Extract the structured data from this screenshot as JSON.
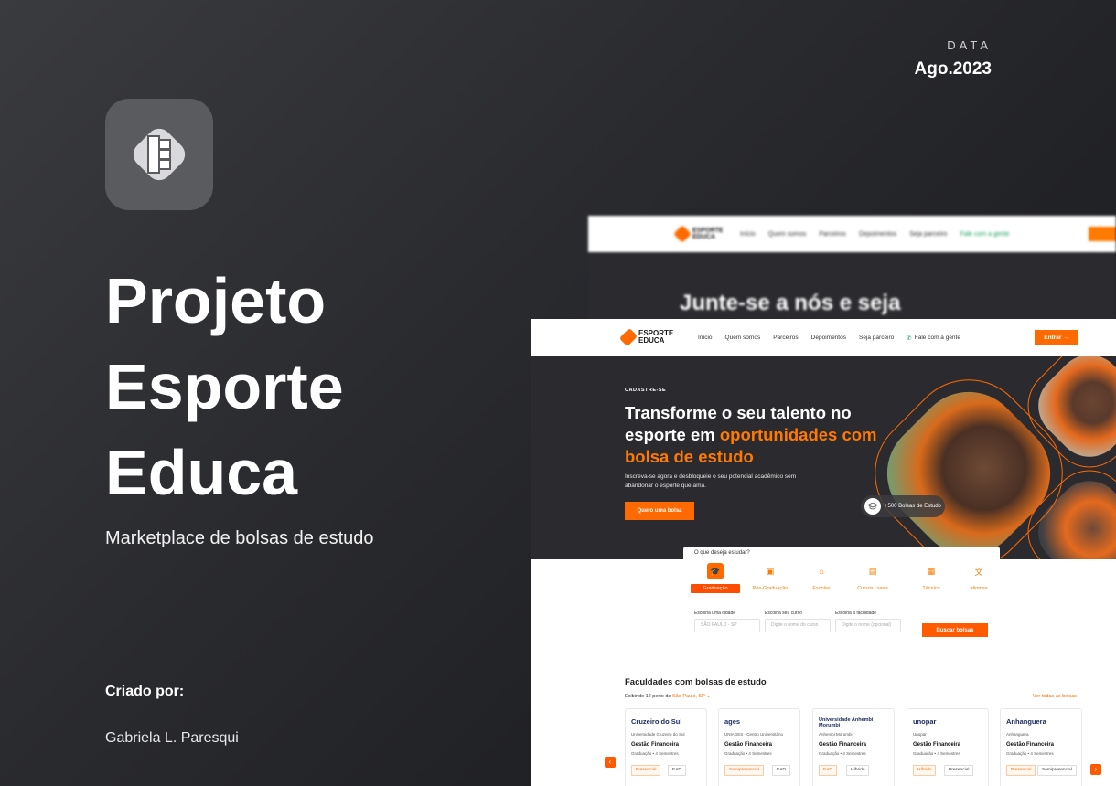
{
  "cover": {
    "date_label": "DATA",
    "date_value": "Ago.2023",
    "title_line1": "Projeto",
    "title_line2": "Esporte",
    "title_line3": "Educa",
    "subtitle": "Marketplace de bolsas de estudo",
    "created_label": "Criado por:",
    "author": "Gabriela L. Paresqui"
  },
  "back_mock": {
    "nav": [
      "Início",
      "Quem somos",
      "Parceiros",
      "Depoimentos",
      "Seja parceiro",
      "Fale com a gente"
    ],
    "hero_text": "Junte-se a nós e seja"
  },
  "site": {
    "logo_line1": "ESPORTE",
    "logo_line2": "EDUCA",
    "nav": {
      "inicio": "Início",
      "quem_somos": "Quem somos",
      "parceiros": "Parceiros",
      "depoimentos": "Depoimentos",
      "seja_parceiro": "Seja parceiro",
      "fale": "Fale com a gente"
    },
    "enter_button": "Entrar →",
    "hero": {
      "eyebrow": "CADASTRE-SE",
      "title_plain": "Transforme o seu talento no esporte em ",
      "title_highlight": "oportunidades com bolsa de estudo",
      "paragraph": "Inscreva-se agora e desbloqueie o seu potencial acadêmico sem abandonar o esporte que ama.",
      "cta": "Quero uma bolsa",
      "badge": "+500 Bolsas de Estudo"
    },
    "search": {
      "question": "O que deseja estudar?",
      "categories": [
        {
          "label": "Graduação",
          "icon": "graduation-cap-icon"
        },
        {
          "label": "Pós-Graduação",
          "icon": "briefcase-icon"
        },
        {
          "label": "Escolas",
          "icon": "school-icon"
        },
        {
          "label": "Cursos Livres",
          "icon": "book-icon"
        },
        {
          "label": "Técnico",
          "icon": "tool-icon"
        },
        {
          "label": "Idiomas",
          "icon": "translate-icon"
        }
      ],
      "city_label": "Escolha uma cidade",
      "city_value": "SÃO PAULO - SP",
      "course_label": "Escolha seu curso",
      "course_placeholder": "Digite o nome do curso",
      "faculty_label": "Escolha a faculdade",
      "faculty_placeholder": "Digite o nome (opcional)",
      "button": "Buscar bolsas"
    },
    "faculties": {
      "title": "Faculdades com bolsas de estudo",
      "showing": "Exibindo 12 perto de",
      "location": "São Paulo, SP",
      "see_all": "Ver todas as bolsas",
      "cards": [
        {
          "brand": "Cruzeiro do Sul",
          "uni": "Universidade Cruzeiro do Sul",
          "course": "Gestão Financeira",
          "duration": "Graduação • 4 Semestres",
          "tag1": "Presencial",
          "tag2": "EAD"
        },
        {
          "brand": "ages",
          "uni": "UNIAGES - Centro Universitário",
          "course": "Gestão Financeira",
          "duration": "Graduação • 4 Semestres",
          "tag1": "Semipresencial",
          "tag2": "EAD"
        },
        {
          "brand": "Universidade Anhembi Morumbi",
          "uni": "Anhembi Morumbi",
          "course": "Gestão Financeira",
          "duration": "Graduação • 4 Semestres",
          "tag1": "EAD",
          "tag2": "Híbrido"
        },
        {
          "brand": "unopar",
          "uni": "Unopar",
          "course": "Gestão Financeira",
          "duration": "Graduação • 4 Semestres",
          "tag1": "Híbrido",
          "tag2": "Presencial"
        },
        {
          "brand": "Anhanguera",
          "uni": "Anhanguera",
          "course": "Gestão Financeira",
          "duration": "Graduação • 4 Semestres",
          "tag1": "Presencial",
          "tag2": "Semipresencial"
        }
      ]
    }
  },
  "colors": {
    "accent": "#ff6a00",
    "dark": "#2b2a2e",
    "bg": "#2a2b2f"
  }
}
